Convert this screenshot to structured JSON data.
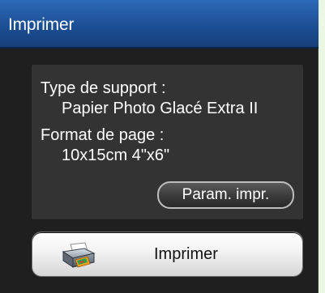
{
  "window": {
    "title": "Imprimer"
  },
  "info": {
    "media_type_label": "Type de support :",
    "media_type_value": "Papier Photo Glacé Extra II",
    "page_size_label": "Format de page :",
    "page_size_value": "10x15cm 4\"x6\""
  },
  "buttons": {
    "print_settings": "Param. impr.",
    "print": "Imprimer"
  },
  "icons": {
    "print_button_icon": "printer-icon"
  },
  "colors": {
    "title_bar": "#1c4f95",
    "panel_background": "#1f1f1f",
    "info_box": "#333333",
    "page_background": "#e9f7e3"
  }
}
